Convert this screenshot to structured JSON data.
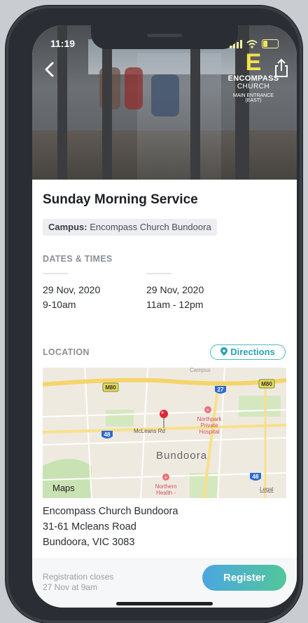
{
  "status": {
    "time": "11:19"
  },
  "hero": {
    "logo_line1": "ENCOMPASS",
    "logo_line2": "CHURCH",
    "logo_line3": "MAIN ENTRANCE",
    "logo_line4": "(EAST)",
    "logo_mark": "E"
  },
  "event": {
    "title": "Sunday Morning Service",
    "campus_label": "Campus:",
    "campus_value": " Encompass Church Bundoora"
  },
  "dates": {
    "label": "DATES & TIMES",
    "items": [
      {
        "date": "29 Nov, 2020",
        "time": "9-10am"
      },
      {
        "date": "29 Nov, 2020",
        "time": "11am - 12pm"
      }
    ]
  },
  "location": {
    "label": "LOCATION",
    "directions": "Directions",
    "address": [
      "Encompass Church Bundoora",
      "31-61 Mcleans Road",
      "Bundoora, VIC 3083"
    ]
  },
  "map": {
    "road_shield_m80": "M80",
    "road_shield_27": "27",
    "road_shield_48": "48",
    "street": "McLeans Rd",
    "suburb": "Bundoora",
    "hospital1": [
      "Northpark",
      "Private",
      "Hospital"
    ],
    "hospital2": [
      "Northern",
      "Health -"
    ],
    "brand": "Maps",
    "legal": "Legal",
    "top_text": "Campus"
  },
  "footer": {
    "reg_line1": "Registration closes",
    "reg_line2": "27 Nov at 9am",
    "register": "Register"
  },
  "colors": {
    "accent": "#2aa2b3",
    "button_start": "#4ca6e0",
    "button_end": "#52c79a"
  }
}
